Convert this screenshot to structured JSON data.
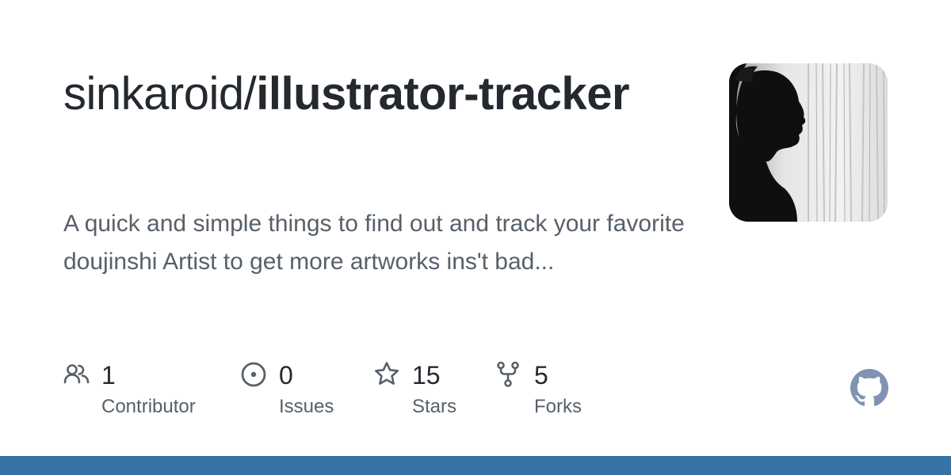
{
  "repo": {
    "owner": "sinkaroid/",
    "name": "illustrator-tracker",
    "description": "A quick and simple things to find out and track your favorite doujinshi Artist to get more artworks ins't bad..."
  },
  "stats": [
    {
      "icon": "people-icon",
      "value": "1",
      "label": "Contributor"
    },
    {
      "icon": "issue-opened-icon",
      "value": "0",
      "label": "Issues"
    },
    {
      "icon": "star-icon",
      "value": "15",
      "label": "Stars"
    },
    {
      "icon": "repo-forked-icon",
      "value": "5",
      "label": "Forks"
    }
  ],
  "colors": {
    "title": "#24292f",
    "muted": "#57606a",
    "icon": "#57606a",
    "github_logo": "#8193b2",
    "bottom_bar": "#3572a5"
  },
  "avatar": {
    "icon": "user-avatar"
  },
  "brand": {
    "icon": "github-logo-icon"
  }
}
